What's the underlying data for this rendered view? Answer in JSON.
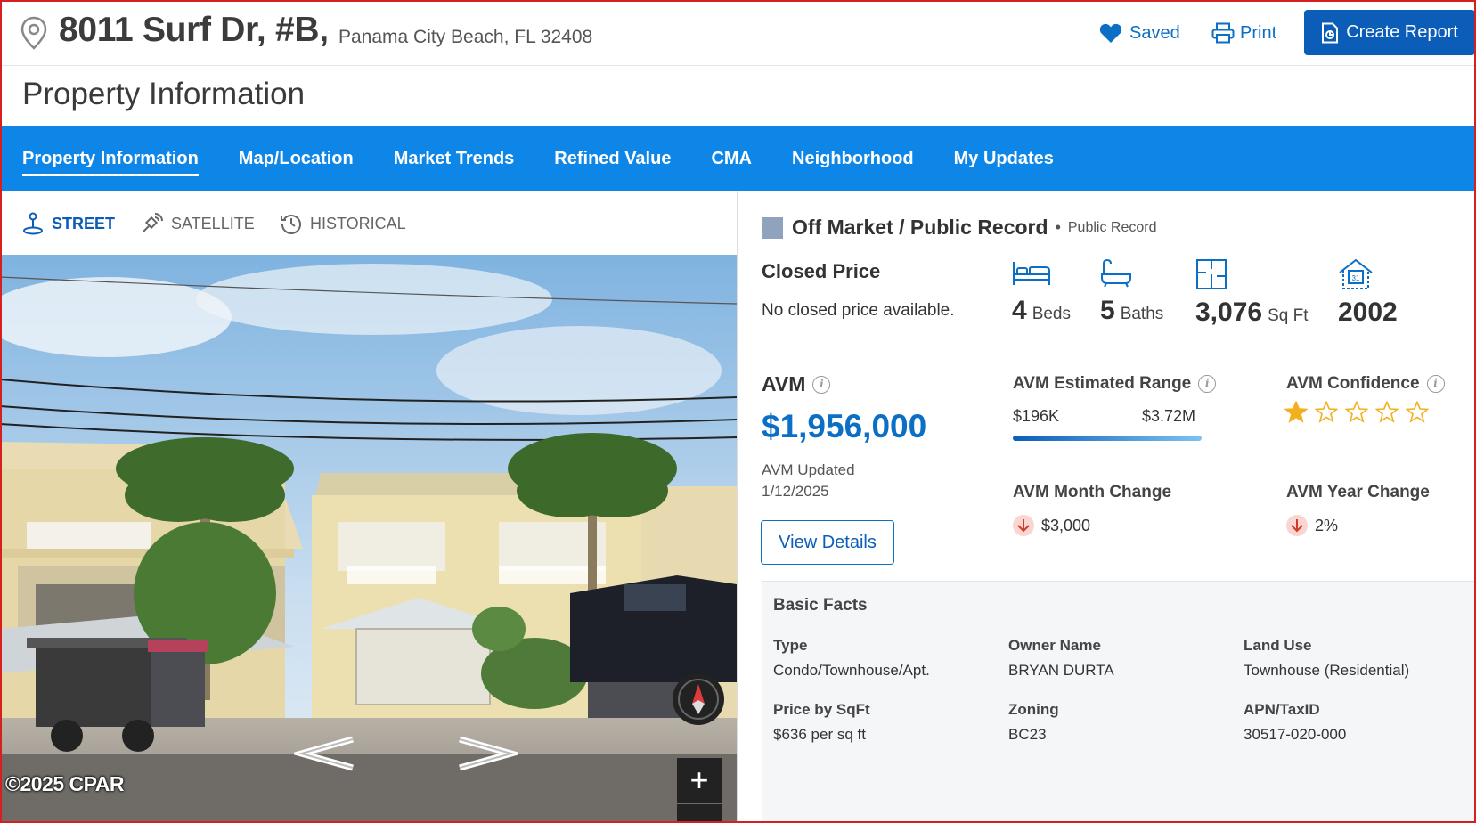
{
  "header": {
    "address_main": "8011 Surf Dr, #B,",
    "address_city": "Panama City Beach, FL 32408",
    "saved_label": "Saved",
    "print_label": "Print",
    "report_label": "Create Report"
  },
  "page_title": "Property Information",
  "nav": {
    "tabs": [
      {
        "label": "Property Information",
        "active": true
      },
      {
        "label": "Map/Location"
      },
      {
        "label": "Market Trends"
      },
      {
        "label": "Refined Value"
      },
      {
        "label": "CMA"
      },
      {
        "label": "Neighborhood"
      },
      {
        "label": "My Updates"
      }
    ]
  },
  "view_tabs": {
    "street": "STREET",
    "satellite": "SATELLITE",
    "historical": "HISTORICAL"
  },
  "photo": {
    "credit": "©2025 CPAR",
    "zoom_in": "+"
  },
  "status": {
    "label": "Off Market / Public Record",
    "separator": "•",
    "sub": "Public Record",
    "color": "#8fa3bd"
  },
  "closed": {
    "title": "Closed Price",
    "text": "No closed price available."
  },
  "stats": {
    "beds": {
      "value": "4",
      "unit": "Beds",
      "icon": "bed-icon"
    },
    "baths": {
      "value": "5",
      "unit": "Baths",
      "icon": "bathtub-icon"
    },
    "sqft": {
      "value": "3,076",
      "unit": "Sq Ft",
      "icon": "floorplan-icon"
    },
    "year": {
      "value": "2002",
      "icon": "calendar-house-icon"
    }
  },
  "avm": {
    "label": "AVM",
    "value": "$1,956,000",
    "updated_label": "AVM Updated",
    "updated_date": "1/12/2025",
    "details_button": "View Details",
    "range_label": "AVM Estimated Range",
    "range_low": "$196K",
    "range_high": "$3.72M",
    "confidence_label": "AVM Confidence",
    "confidence_stars": 1,
    "confidence_max": 5,
    "month_change_label": "AVM Month Change",
    "month_change_value": "$3,000",
    "year_change_label": "AVM Year Change",
    "year_change_value": "2%"
  },
  "facts": {
    "title": "Basic Facts",
    "type_label": "Type",
    "type_value": "Condo/Townhouse/Apt.",
    "owner_label": "Owner Name",
    "owner_value": "BRYAN DURTA",
    "landuse_label": "Land Use",
    "landuse_value": "Townhouse (Residential)",
    "price_sqft_label": "Price by SqFt",
    "price_sqft_value": "$636 per sq ft",
    "zoning_label": "Zoning",
    "zoning_value": "BC23",
    "apn_label": "APN/TaxID",
    "apn_value": "30517-020-000"
  },
  "colors": {
    "brand_blue": "#0b5db8",
    "nav_blue": "#0e86e8",
    "star_gold": "#f2b01e"
  }
}
